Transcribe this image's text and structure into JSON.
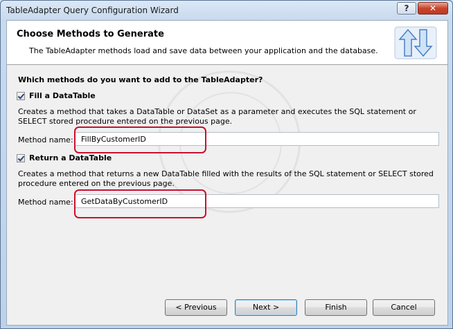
{
  "window": {
    "title": "TableAdapter Query Configuration Wizard",
    "help_label": "?",
    "close_label": "✕"
  },
  "header": {
    "title": "Choose Methods to Generate",
    "description": "The TableAdapter methods load and save data between your application and the database.",
    "icon": "sync-arrows-icon"
  },
  "question": "Which methods do you want to add to the TableAdapter?",
  "fill": {
    "label": "Fill a DataTable",
    "checked": true,
    "description": "Creates a method that takes a DataTable or DataSet as a parameter and executes the SQL statement or SELECT stored procedure entered on the previous page.",
    "method_label": "Method name:",
    "method_value": "FillByCustomerID"
  },
  "return": {
    "label": "Return a DataTable",
    "checked": true,
    "description": "Creates a method that returns a new DataTable filled with the results of the SQL statement or SELECT stored procedure entered on the previous page.",
    "method_label": "Method name:",
    "method_value": "GetDataByCustomerID"
  },
  "buttons": {
    "previous": "< Previous",
    "next": "Next >",
    "finish": "Finish",
    "cancel": "Cancel"
  },
  "colors": {
    "highlight": "#c8102e",
    "accent": "#3c7fb1"
  }
}
